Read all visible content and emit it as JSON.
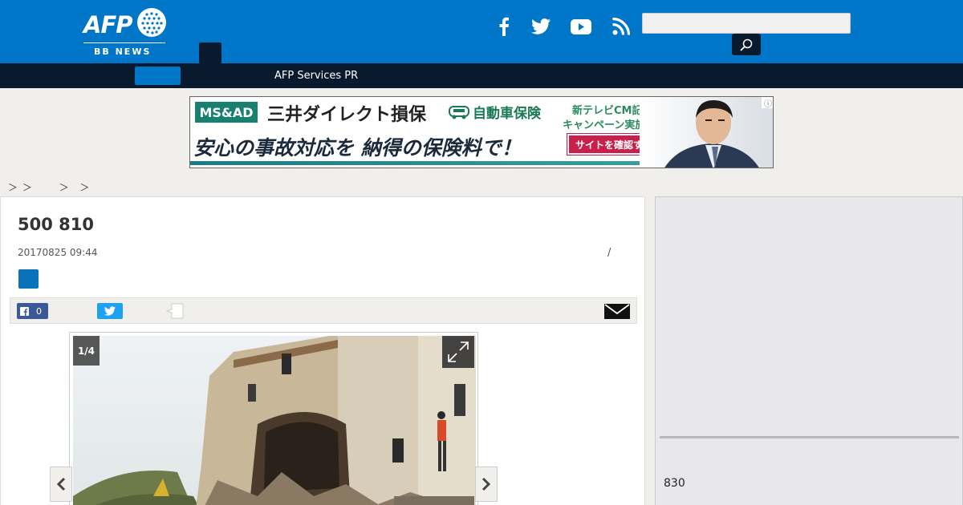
{
  "brand": {
    "logo_text": "AFP",
    "logo_sub": "BB NEWS"
  },
  "header": {
    "search_placeholder": "",
    "social": [
      "facebook-icon",
      "twitter-icon",
      "youtube-icon",
      "rss-icon"
    ]
  },
  "nav": {
    "link_label": "AFP Services PR"
  },
  "ad": {
    "brand": "MS&AD",
    "company": "三井ダイレクト損保",
    "product": "自動車保険",
    "promo_line1": "新テレビCM記念",
    "promo_line2": "キャンペーン実施中！",
    "tagline": "安心の事故対応を 納得の保険料で！",
    "cta": "サイトを確認する"
  },
  "breadcrumb": [
    "＞",
    "＞",
    "＞",
    "＞"
  ],
  "article": {
    "title": "500 810",
    "date": "20170825 09:44",
    "byline_separator": "/",
    "facebook_count": "0",
    "gallery_counter": "1/4"
  },
  "sidebar": {
    "count_text": "830"
  },
  "colors": {
    "header_blue": "#0076c8",
    "nav_dark": "#0a1a2e",
    "facebook": "#3b5998",
    "twitter": "#1da1f2"
  }
}
